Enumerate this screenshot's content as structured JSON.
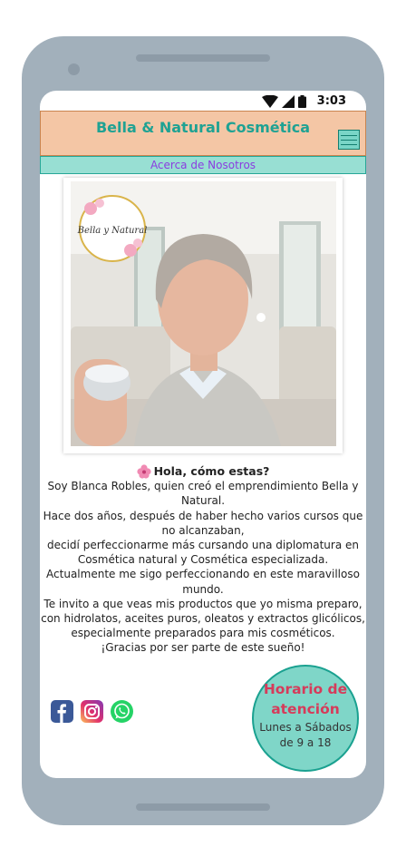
{
  "status_bar": {
    "time": "3:03"
  },
  "header": {
    "title": "Bella & Natural Cosmética"
  },
  "nav": {
    "about_label": "Acerca de Nosotros"
  },
  "photo": {
    "logo_text": "Bella y Natural"
  },
  "intro": {
    "greeting": "Hola, cómo estas?",
    "paragraphs": [
      "Soy Blanca Robles, quien creó el emprendimiento Bella y Natural.",
      "Hace dos años, después de haber hecho varios cursos que no alcanzaban,",
      "decidí perfeccionarme más cursando una diplomatura en Cosmética natural y Cosmética especializada.",
      "Actualmente me sigo perfeccionando en este maravilloso mundo.",
      "Te invito a que veas mis productos que yo misma preparo, con hidrolatos, aceites puros, oleatos y extractos glicólicos, especialmente preparados para mis cosméticos.",
      "¡Gracias por ser parte de este sueño!"
    ]
  },
  "social": {
    "icons": [
      "facebook-icon",
      "instagram-icon",
      "whatsapp-icon"
    ]
  },
  "schedule": {
    "title": "Horario de atención",
    "line1": "Lunes a Sábados",
    "line2": "de 9 a 18"
  },
  "colors": {
    "accent": "#1fa293",
    "header_bg": "#f4c6a5",
    "nav_bg": "#98dfd3",
    "nav_text": "#8b3ce0",
    "schedule_title": "#d63b5a"
  }
}
